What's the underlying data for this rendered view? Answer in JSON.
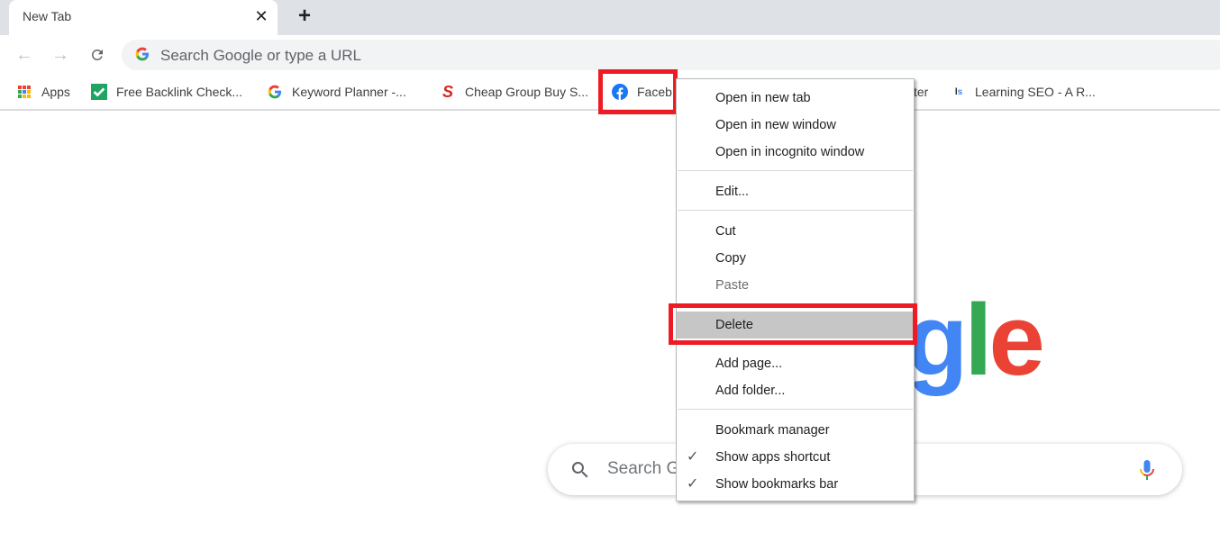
{
  "tabstrip": {
    "tab_title": "New Tab",
    "close_icon": "close-icon",
    "new_tab_icon": "plus-icon"
  },
  "toolbar": {
    "back_icon": "arrow-left-icon",
    "forward_icon": "arrow-right-icon",
    "reload_icon": "reload-icon",
    "omnibox_placeholder": "Search Google or type a URL"
  },
  "bookmarks": [
    {
      "label": "Apps",
      "icon": "apps-grid-icon"
    },
    {
      "label": "Free Backlink Check...",
      "icon": "green-check-icon"
    },
    {
      "label": "Keyword Planner -...",
      "icon": "google-g-icon"
    },
    {
      "label": "Cheap Group Buy S...",
      "icon": "red-s-icon"
    },
    {
      "label": "Faceb",
      "icon": "facebook-icon"
    },
    {
      "label": "ter",
      "icon": ""
    },
    {
      "label": "Learning SEO - A R...",
      "icon": "ls-icon"
    }
  ],
  "context_menu": {
    "items": [
      {
        "label": "Open in new tab"
      },
      {
        "label": "Open in new window"
      },
      {
        "label": "Open in incognito window"
      },
      {
        "label": "Edit..."
      },
      {
        "label": "Cut"
      },
      {
        "label": "Copy"
      },
      {
        "label": "Paste",
        "disabled": true
      },
      {
        "label": "Delete",
        "selected": true
      },
      {
        "label": "Add page..."
      },
      {
        "label": "Add folder..."
      },
      {
        "label": "Bookmark manager"
      },
      {
        "label": "Show apps shortcut",
        "checked": true
      },
      {
        "label": "Show bookmarks bar",
        "checked": true
      }
    ]
  },
  "page": {
    "logo_visible": "gle",
    "search_placeholder": "Search G"
  },
  "colors": {
    "highlight_red": "#ed1c24",
    "google_blue": "#4285f4",
    "google_green": "#34a853",
    "google_red": "#ea4335",
    "google_yellow": "#fbbc05"
  }
}
